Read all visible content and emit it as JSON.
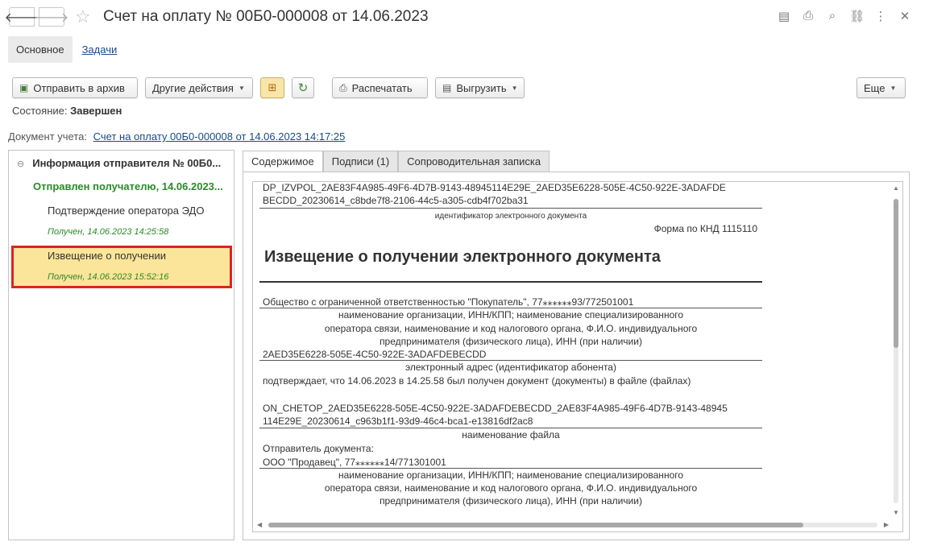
{
  "window": {
    "title": "Счет на оплату № 00Б0-000008 от 14.06.2023",
    "back_icon": "🡐",
    "forward_icon": "🡒",
    "star_icon": "☆",
    "icons": [
      "save-icon",
      "print-icon",
      "preview-icon",
      "link-icon",
      "more-icon",
      "close-icon"
    ],
    "icon_glyphs": [
      "▤",
      "⎙",
      "⌕",
      "⛓",
      "⋮",
      "✕"
    ]
  },
  "section_tabs": {
    "main": "Основное",
    "tasks": "Задачи"
  },
  "toolbar": {
    "archive": "Отправить в архив",
    "other_actions": "Другие действия",
    "print": "Распечатать",
    "export": "Выгрузить",
    "more": "Еще"
  },
  "state": {
    "label": "Состояние:",
    "value": "Завершен"
  },
  "document": {
    "label": "Документ учета:",
    "link": "Счет на оплату 00Б0-000008 от 14.06.2023 14:17:25"
  },
  "tree": {
    "root": "Информация отправителя № 00Б0...",
    "sent": "Отправлен получателю, 14.06.2023...",
    "confirm": "Подтверждение оператора ЭДО",
    "confirm_status": "Получен, 14.06.2023 14:25:58",
    "notice": "Извещение о получении",
    "notice_status": "Получен, 14.06.2023 15:52:16"
  },
  "content_tabs": [
    "Содержимое",
    "Подписи (1)",
    "Сопроводительная записка"
  ],
  "doc": {
    "id_line1": "DP_IZVPOL_2AE83F4A985-49F6-4D7B-9143-48945114E29E_2AED35E6228-505E-4C50-922E-3ADAFDE",
    "id_line2": "BECDD_20230614_c8bde7f8-2106-44c5-a305-cdb4f702ba31",
    "id_caption": "идентификатор электронного документа",
    "form": "Форма по КНД 1115110",
    "heading": "Извещение о получении электронного документа",
    "org": "Общество с ограниченной ответственностью \"Покупатель\", 77⁎⁎⁎⁎⁎⁎93/772501001",
    "org_caption1": "наименование организации, ИНН/КПП; наименование специализированного",
    "org_caption2": "оператора связи, наименование и код налогового органа, Ф.И.О. индивидуального",
    "org_caption3": "предпринимателя (физического лица), ИНН (при наличии)",
    "address": "2AED35E6228-505E-4C50-922E-3ADAFDEBECDD",
    "address_caption": "электронный адрес (идентификатор абонента)",
    "confirms": "подтверждает, что 14.06.2023 в 14.25.58 был получен документ (документы) в файле (файлах)",
    "file_line1": "ON_CHETOP_2AED35E6228-505E-4C50-922E-3ADAFDEBECDD_2AE83F4A985-49F6-4D7B-9143-48945",
    "file_line2": "114E29E_20230614_c963b1f1-93d9-46c4-bca1-e13816df2ac8",
    "file_caption": "наименование файла",
    "sender_label": "Отправитель документа:",
    "sender": "ООО \"Продавец\", 77⁎⁎⁎⁎⁎⁎14/771301001",
    "sender_caption1": "наименование организации, ИНН/КПП; наименование специализированного",
    "sender_caption2": "оператора связи, наименование и код налогового органа, Ф.И.О. индивидуального",
    "sender_caption3": "предпринимателя (физического лица), ИНН (при наличии)"
  }
}
